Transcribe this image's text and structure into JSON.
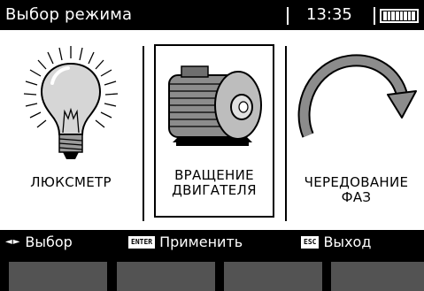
{
  "header": {
    "title": "Выбор режима",
    "time": "13:35",
    "battery_level": 1.0
  },
  "modes": [
    {
      "label_line1": "ЛЮКСМЕТР",
      "label_line2": "",
      "icon": "light-bulb-icon",
      "selected": false
    },
    {
      "label_line1": "ВРАЩЕНИЕ",
      "label_line2": "ДВИГАТЕЛЯ",
      "icon": "motor-icon",
      "selected": true
    },
    {
      "label_line1": "ЧЕРЕДОВАНИЕ",
      "label_line2": "ФАЗ",
      "icon": "phase-rotation-arrow-icon",
      "selected": false
    }
  ],
  "hints": {
    "select_keys": "◄►",
    "select_label": "Выбор",
    "enter_key": "ENTER",
    "enter_label": "Применить",
    "esc_key": "ESC",
    "esc_label": "Выход"
  },
  "colors": {
    "background": "#000000",
    "panel": "#ffffff",
    "text_on_dark": "#ffffff",
    "function_key": "#535353"
  },
  "function_keys": [
    "",
    "",
    "",
    ""
  ]
}
